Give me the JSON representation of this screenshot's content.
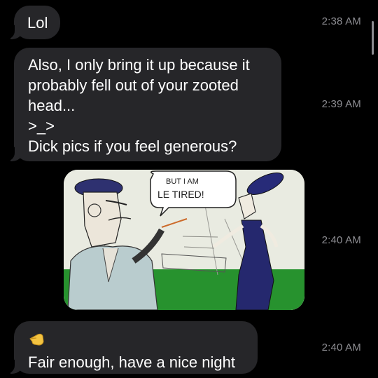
{
  "messages": [
    {
      "text": "Lol",
      "time": "2:38 AM"
    },
    {
      "text": "Also, I only bring it up because it\nprobably fell out of your zooted\nhead...\n>_>\nDick pics if you feel generous?",
      "time": "2:39 AM"
    },
    {
      "image_caption": "BUT I AM\nLE TIRED!",
      "time": "2:40 AM"
    },
    {
      "emoji": "pointing-hand-icon",
      "text": "Fair enough, have a nice night",
      "time": "2:40 AM"
    }
  ],
  "colors": {
    "background": "#000000",
    "incoming_bubble": "#262629",
    "timestamp": "#8e8e93",
    "text": "#ffffff"
  }
}
